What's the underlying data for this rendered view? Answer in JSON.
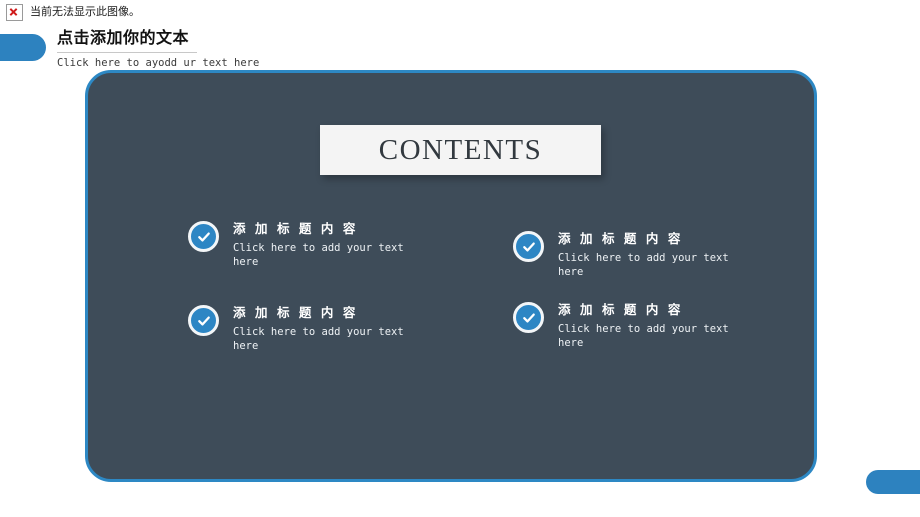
{
  "browser_notice": {
    "icon": "broken-image-icon",
    "text": "当前无法显示此图像。"
  },
  "header": {
    "title": "点击添加你的文本",
    "subtitle": "Click here to ayodd ur text here"
  },
  "slide": {
    "contents_label": "CONTENTS",
    "items": [
      {
        "icon": "check-circle-icon",
        "heading": "添 加 标 题 内 容",
        "body": "Click here to add your text here"
      },
      {
        "icon": "check-circle-icon",
        "heading": "添 加 标 题 内 容",
        "body": "Click here to add your text here"
      },
      {
        "icon": "check-circle-icon",
        "heading": "添 加 标 题 内 容",
        "body": "Click here to add your text here"
      },
      {
        "icon": "check-circle-icon",
        "heading": "添 加 标 题 内 容",
        "body": "Click here to add your text here"
      }
    ]
  },
  "colors": {
    "accent_blue": "#2d82bf",
    "panel_border_blue": "#2d88c4",
    "panel_slate": "#3e4c59",
    "card_white": "#f4f4f4",
    "badge_blue": "#2d86c4"
  }
}
